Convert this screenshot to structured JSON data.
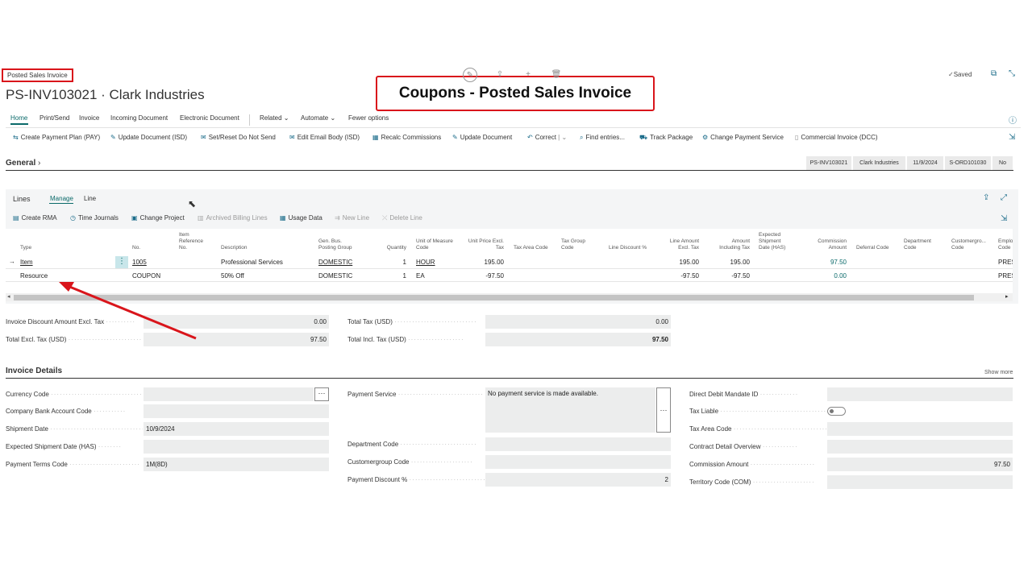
{
  "page": {
    "tag": "Posted Sales Invoice",
    "title": "PS-INV103021 · Clark Industries",
    "banner": "Coupons - Posted Sales Invoice",
    "saved": "Saved"
  },
  "nav": {
    "tabs": [
      "Home",
      "Print/Send",
      "Invoice",
      "Incoming Document",
      "Electronic Document",
      "Related",
      "Automate",
      "Fewer options"
    ]
  },
  "actions": [
    "Create Payment Plan (PAY)",
    "Update Document (ISD)",
    "Set/Reset Do Not Send",
    "Edit Email Body (ISD)",
    "Recalc Commissions",
    "Update Document",
    "Correct",
    "Find entries...",
    "Track Package",
    "Change Payment Service",
    "Commercial Invoice (DCC)"
  ],
  "general": {
    "label": "General",
    "chips": [
      "PS-INV103021",
      "Clark Industries",
      "11/9/2024",
      "S-ORD101030",
      "No"
    ]
  },
  "lines": {
    "title": "Lines",
    "tabs": [
      "Manage",
      "Line"
    ],
    "actions": [
      "Create RMA",
      "Time Journals",
      "Change Project",
      "Archived Billing Lines",
      "Usage Data",
      "New Line",
      "Delete Line"
    ],
    "headers": {
      "type": "Type",
      "no": "No.",
      "item_ref": "Item Reference No.",
      "description": "Description",
      "gen_bus": "Gen. Bus. Posting Group",
      "quantity": "Quantity",
      "uom": "Unit of Measure Code",
      "unit_price": "Unit Price Excl. Tax",
      "tax_area": "Tax Area Code",
      "tax_group": "Tax Group Code",
      "line_disc": "Line Discount %",
      "line_amt": "Line Amount Excl. Tax",
      "amt_incl": "Amount Including Tax",
      "exp_ship": "Expected Shipment Date (HAS)",
      "commission": "Commission Amount",
      "deferral": "Deferral Code",
      "department": "Department Code",
      "customergroup": "Customergro... Code",
      "employee": "Emplo Code"
    },
    "rows": [
      {
        "type": "Item",
        "no": "1005",
        "description": "Professional Services",
        "gen_bus": "DOMESTIC",
        "quantity": "1",
        "uom": "HOUR",
        "unit_price": "195.00",
        "line_amt": "195.00",
        "amt_incl": "195.00",
        "commission": "97.50",
        "employee": "PRES"
      },
      {
        "type": "Resource",
        "no": "COUPON",
        "description": "50% Off",
        "gen_bus": "DOMESTIC",
        "quantity": "1",
        "uom": "EA",
        "unit_price": "-97.50",
        "line_amt": "-97.50",
        "amt_incl": "-97.50",
        "commission": "0.00",
        "employee": "PRES"
      }
    ]
  },
  "totals": {
    "inv_disc_label": "Invoice Discount Amount Excl. Tax",
    "inv_disc_value": "0.00",
    "total_excl_label": "Total Excl. Tax (USD)",
    "total_excl_value": "97.50",
    "total_tax_label": "Total Tax (USD)",
    "total_tax_value": "0.00",
    "total_incl_label": "Total Incl. Tax (USD)",
    "total_incl_value": "97.50"
  },
  "invoice_details": {
    "title": "Invoice Details",
    "show_more": "Show more",
    "col1": [
      {
        "label": "Currency Code",
        "value": ""
      },
      {
        "label": "Company Bank Account Code",
        "value": ""
      },
      {
        "label": "Shipment Date",
        "value": "10/9/2024"
      },
      {
        "label": "Expected Shipment Date (HAS)",
        "value": ""
      },
      {
        "label": "Payment Terms Code",
        "value": "1M(8D)"
      }
    ],
    "col2": [
      {
        "label": "Payment Service",
        "value": "No payment service is made available."
      },
      {
        "label": "Department Code",
        "value": ""
      },
      {
        "label": "Customergroup Code",
        "value": ""
      },
      {
        "label": "Payment Discount %",
        "value": "2"
      }
    ],
    "col3": [
      {
        "label": "Direct Debit Mandate ID",
        "value": ""
      },
      {
        "label": "Tax Liable",
        "value": ""
      },
      {
        "label": "Tax Area Code",
        "value": ""
      },
      {
        "label": "Contract Detail Overview",
        "value": ""
      },
      {
        "label": "Commission Amount",
        "value": "97.50"
      },
      {
        "label": "Territory Code (COM)",
        "value": ""
      }
    ]
  },
  "colors": {
    "accent": "#0b6a6a",
    "highlight": "#d9151b"
  }
}
